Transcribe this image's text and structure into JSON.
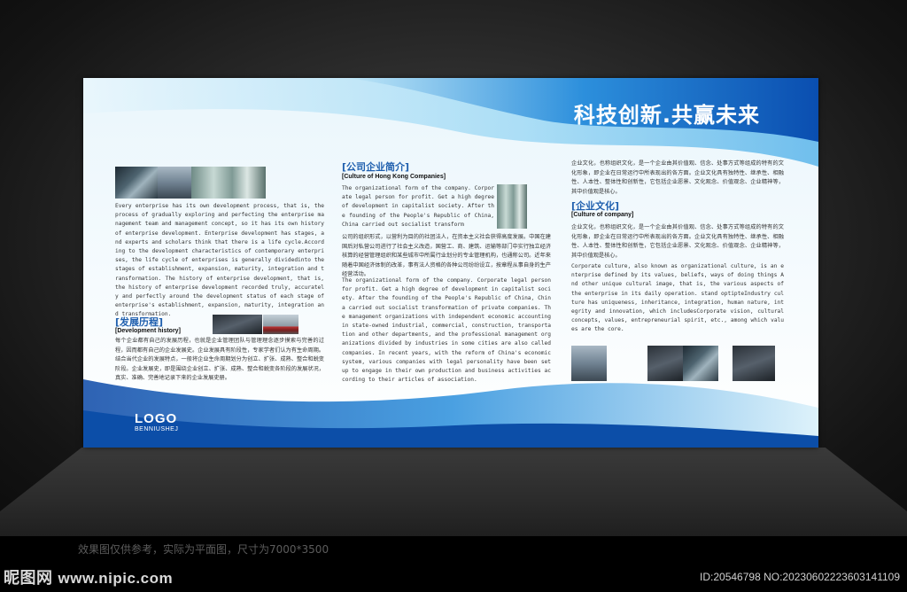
{
  "board": {
    "headline": "科技创新.共赢未来",
    "logo": {
      "text": "LOGO",
      "subtitle": "BENNIUSHEJ"
    }
  },
  "column1": {
    "intro_en": "Every enterprise has its own development process, that is, the process of gradually exploring and perfecting the enterprise management team and management concept, so it has its own history of enterprise development. Enterprise development has stages, and experts and scholars think that there is a life cycle.According to the development characteristics of contemporary enterprises, the life cycle of enterprises is generally dividedinto the stages of establishment, expansion, maturity, integration and transformation. The history of enterprise development, that is, the history of enterprise development recorded truly, accurately and perfectly around the development status of each stage of enterprise's establishment, expansion, maturity, integration and transformation.",
    "heading_cn": "[发展历程]",
    "heading_en": "[Development history]",
    "body_cn": "每个企业都有自己的发展历程，也就是企业管理团队与管理理念逐步摸索与完善的过程，因而都有自己的企业发展史。企业发展具有阶段性，专家学者们认为有生命周期。结合当代企业的发展特点，一般将企业生命周期划分为创立、扩张、成熟、整合和蜕变阶段。企业发展史，即是围绕企业创立、扩张、成熟、整合和蜕变各阶段的发展状况，真实、准确、完善地记录下来的企业发展史册。"
  },
  "column2": {
    "heading_cn": "[公司企业简介]",
    "heading_en": "[Culture of Hong Kong Companies]",
    "intro_en": "The organizational form of the company. Corporate legal person for profit. Get a high degree of development in capitalist society. After the founding of the People's Republic of China, China carried out socialist transform",
    "body_cn": "公司的组织形式，以营利为目的的社团法人，在资本主义社会获得高度发展。中国在建国后对私营公司进行了社会主义改造，国营工、商、建筑、运输等部门中实行独立经济核算的经营管理组织和某些城市中所属行业划分的专业管理机构，也通称公司。近年来随着中国经济体制的改革，事有法人资格的各种公司纷纷设立，按章程从事自身的生产经营活动。",
    "body_en": "The organizational form of the company. Corporate legal person for profit. Get a high degree of development in capitalist society. After the founding of the People's Republic of China, China carried out socialist transformation of private companies. The management organizations with independent economic accounting in state-owned industrial, commercial, construction, transportation and other departments, and the professional management organizations divided by industries in some cities are also called companies. In recent years, with the reform of China's economic system, various companies with legal personality have been set up to engage in their own production and business activities according to their articles of association."
  },
  "column3": {
    "intro_cn": "企业文化，也称组织文化，是一个企业由其价值观、信念、处事方式等组成的特有的文化形象，即企业在日常运行中所表现出的各方面。企业文化具有独特性、继承性、相融性、人本性、整体性和创新性，它包括企业愿景、文化观念、价值观念、企业精神等，其中价值观是核心。",
    "heading_cn": "[企业文化]",
    "heading_en": "[Culture of company]",
    "body_cn": "企业文化，也称组织文化，是一个企业由其价值观、信念、处事方式等组成的特有的文化形象，即企业在日常运行中所表现出的各方面。企业文化具有独特性、继承性、相融性、人本性、整体性和创新性，它包括企业愿景、文化观念、价值观念、企业精神等，其中价值观是核心。",
    "body_en": "Corporate culture, also known as organizational culture, is an enterprise defined by its values, beliefs, ways of doing things And other unique cultural image, that is, the various aspects of the enterprise in its daily operation. stand optipteIndustry culture has uniqueness, inheritance, integration, human nature, integrity and innovation, which includesCorporate vision, cultural concepts, values, entrepreneurial spirit, etc., among which values are the core."
  },
  "caption": "效果图仅供参考，实际为平面图，尺寸为7000*3500",
  "watermark": {
    "brand": "昵图网",
    "url": "www.nipic.com",
    "id_text": "ID:20546798 NO:20230602223603141109"
  },
  "colors": {
    "brand_blue": "#1f5fae",
    "wave_dark": "#0b4fb0",
    "wave_light": "#7fd0f2"
  }
}
